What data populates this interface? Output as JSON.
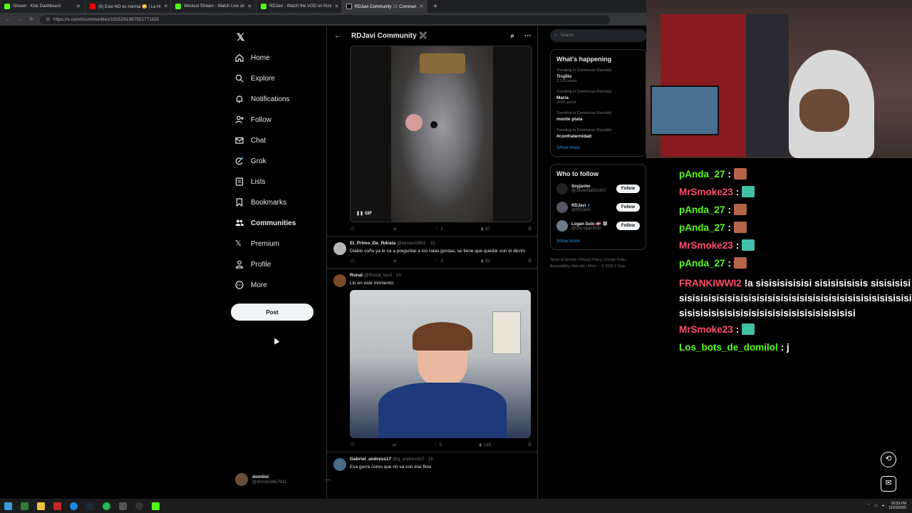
{
  "browser": {
    "tabs": [
      {
        "label": "Stream - Kick Dashboard",
        "favicon_color": "#53fc18",
        "active": false
      },
      {
        "label": "(6) Esto NO es normal 😳 | La Hi",
        "favicon_color": "#ff0000",
        "active": false
      },
      {
        "label": "Westcol Stream - Watch Live on",
        "favicon_color": "#53fc18",
        "active": false
      },
      {
        "label": "RDJavi - Watch the VOD on Kick",
        "favicon_color": "#53fc18",
        "active": false
      },
      {
        "label": "RDJavi Community ✖️ Commun",
        "favicon_color": "#e7e9ea",
        "active": true
      }
    ],
    "url": "https://x.com/i/communities/1925291967551771115"
  },
  "nav": {
    "logo": "x-logo",
    "items": [
      {
        "label": "Home",
        "icon": "home-icon"
      },
      {
        "label": "Explore",
        "icon": "search-icon"
      },
      {
        "label": "Notifications",
        "icon": "bell-icon"
      },
      {
        "label": "Follow",
        "icon": "person-add-icon"
      },
      {
        "label": "Chat",
        "icon": "mail-icon"
      },
      {
        "label": "Grok",
        "icon": "grok-icon"
      },
      {
        "label": "Lists",
        "icon": "list-icon"
      },
      {
        "label": "Bookmarks",
        "icon": "bookmark-icon"
      },
      {
        "label": "Communities",
        "icon": "communities-icon"
      },
      {
        "label": "Premium",
        "icon": "x-logo-icon"
      },
      {
        "label": "Profile",
        "icon": "person-icon"
      },
      {
        "label": "More",
        "icon": "more-circle-icon"
      }
    ],
    "post_label": "Post",
    "account": {
      "name": "domilol",
      "handle": "@domilol467611"
    }
  },
  "feed": {
    "title": "RDJavi Community ✖️",
    "gif_label": "GIF",
    "gif_post_stats": {
      "likes": "1",
      "views": "97"
    },
    "posts": [
      {
        "name": "El_Primo_De_Rdrata",
        "handle": "@landa43902",
        "time": "1h",
        "text": "Diablo coño ya le va a preguntar a los ratas gordas, se tiene que quedar con el dicrim",
        "likes": "3",
        "views": "91"
      },
      {
        "name": "Ronal",
        "handle": "@Ronal_lov3",
        "time": "1h",
        "text": "Llo en este momento:",
        "likes": "5",
        "views": "125"
      },
      {
        "name": "Gabriel_andress17",
        "handle": "@g_andress17",
        "time": "1h",
        "text": "Esa gorra como que no va con ese flow"
      }
    ]
  },
  "sidebar": {
    "search_placeholder": "Search",
    "happening_title": "What's happening",
    "trends": [
      {
        "context": "Trending in Dominican Republic",
        "name": "Trujillo",
        "count": "2,105 posts"
      },
      {
        "context": "Trending in Dominican Republic",
        "name": "Maria",
        "count": "207K posts"
      },
      {
        "context": "Trending in Dominican Republic",
        "name": "monte plata",
        "count": ""
      },
      {
        "context": "Trending in Dominican Republic",
        "name": "#confraternidad",
        "count": ""
      }
    ],
    "show_more": "Show more",
    "who_to_follow_title": "Who to follow",
    "follow_suggestions": [
      {
        "name": "Soyjavier_",
        "handle": "@JavierBati91947",
        "button": "Follow"
      },
      {
        "name": "RDJavi",
        "handle": "@RDJavii",
        "button": "Follow"
      },
      {
        "name": "Logan Solo 🇩🇴 🐺",
        "handle": "@ImLoganSolo",
        "button": "Follow"
      }
    ],
    "footer_links": [
      "Terms of Service",
      "Privacy Policy",
      "Cookie Policy",
      "Accessibility",
      "Ads info",
      "More ···",
      "© 2025 X Corp."
    ]
  },
  "chat": {
    "messages": [
      {
        "user": "pAnda_27",
        "color": "#53fc18",
        "text": "",
        "emote": "face-emote"
      },
      {
        "user": "MrSmoke23",
        "color": "#ff4d6d",
        "text": "",
        "emote": "feather-emote"
      },
      {
        "user": "pAnda_27",
        "color": "#53fc18",
        "text": "",
        "emote": "face-emote"
      },
      {
        "user": "pAnda_27",
        "color": "#53fc18",
        "text": "",
        "emote": "face-emote"
      },
      {
        "user": "MrSmoke23",
        "color": "#ff4d6d",
        "text": "",
        "emote": "feather-emote"
      },
      {
        "user": "pAnda_27",
        "color": "#53fc18",
        "text": "",
        "emote": "face-emote"
      },
      {
        "user": "FRANKIWWI2",
        "color": "#ff4d6d",
        "text": "!a sisisisisisisi sisisisisisis sisisisisisisisisisisisisisisisisisisisisisisisisisisisisisisisisisisisisisisisisisisisisisisisisisisisisisisisi",
        "emote": ""
      },
      {
        "user": "MrSmoke23",
        "color": "#ff4d6d",
        "text": "",
        "emote": "feather-emote"
      },
      {
        "user": "Los_bots_de_domilol",
        "color": "#53fc18",
        "text": ": j",
        "emote": ""
      }
    ]
  },
  "taskbar": {
    "time": "10:59 PM",
    "date": "12/20/2025"
  }
}
